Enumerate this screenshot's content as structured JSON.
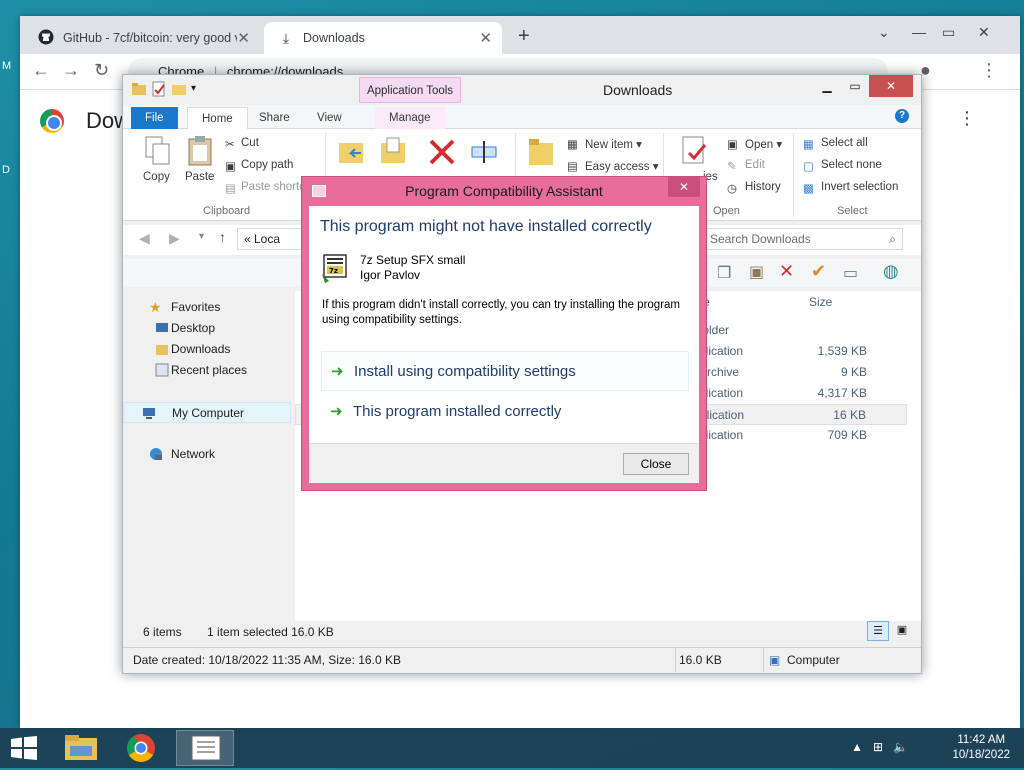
{
  "desktop": {
    "left_chars": [
      "M",
      "D"
    ]
  },
  "chrome": {
    "tabs": [
      {
        "title": "GitHub - 7cf/bitcoin: very good v",
        "icon": "github-icon"
      },
      {
        "title": "Downloads",
        "icon": "download-icon"
      }
    ],
    "omnibox": {
      "site": "Chrome",
      "url": "chrome://downloads"
    },
    "page_title": "Dow"
  },
  "explorer": {
    "title": "Downloads",
    "context_tab": "Application Tools",
    "ribbon_tabs": [
      "File",
      "Home",
      "Share",
      "View",
      "Manage"
    ],
    "clipboard": {
      "copy": "Copy",
      "paste": "Paste",
      "cut": "Cut",
      "copy_path": "Copy path",
      "paste_shortcut": "Paste shortc",
      "group": "Clipboard"
    },
    "new_group": {
      "new_item": "New item ▾",
      "easy_access": "Easy access ▾"
    },
    "open_group": {
      "properties": "ies",
      "open": "Open ▾",
      "edit": "Edit",
      "history": "History",
      "group": "Open"
    },
    "select_group": {
      "select_all": "Select all",
      "select_none": "Select none",
      "invert": "Invert selection",
      "group": "Select"
    },
    "address": "«  Loca",
    "search_placeholder": "Search Downloads",
    "nav": [
      {
        "label": "Favorites",
        "icon": "star-icon",
        "top": true
      },
      {
        "label": "Desktop",
        "icon": "desktop-icon"
      },
      {
        "label": "Downloads",
        "icon": "folder-icon"
      },
      {
        "label": "Recent places",
        "icon": "recent-icon"
      },
      {
        "label": "My Computer",
        "icon": "computer-icon",
        "top": true,
        "selected": true
      },
      {
        "label": "Network",
        "icon": "network-icon",
        "top": true
      }
    ],
    "columns": {
      "type": "e",
      "size": "Size"
    },
    "rows": [
      {
        "type": "folder",
        "size": ""
      },
      {
        "type": "plication",
        "size": "1,539 KB"
      },
      {
        "type": "Archive",
        "size": "9 KB"
      },
      {
        "type": "plication",
        "size": "4,317 KB"
      },
      {
        "type": "plication",
        "size": "16 KB",
        "selected": true
      },
      {
        "type": "plication",
        "size": "709 KB"
      }
    ],
    "status_items": "6 items",
    "status_selected": "1 item selected  16.0 KB",
    "details": "Date created: 10/18/2022 11:35 AM, Size: 16.0 KB",
    "details_size": "16.0 KB",
    "details_location": "Computer"
  },
  "dialog": {
    "title": "Program Compatibility Assistant",
    "heading": "This program might not have installed correctly",
    "program_name": "7z Setup SFX small",
    "publisher": "Igor Pavlov",
    "description": "If this program didn't install correctly, you can try installing the program using compatibility settings.",
    "option1": "Install using compatibility settings",
    "option2": "This program installed correctly",
    "close": "Close"
  },
  "taskbar": {
    "time": "11:42 AM",
    "date": "10/18/2022"
  }
}
